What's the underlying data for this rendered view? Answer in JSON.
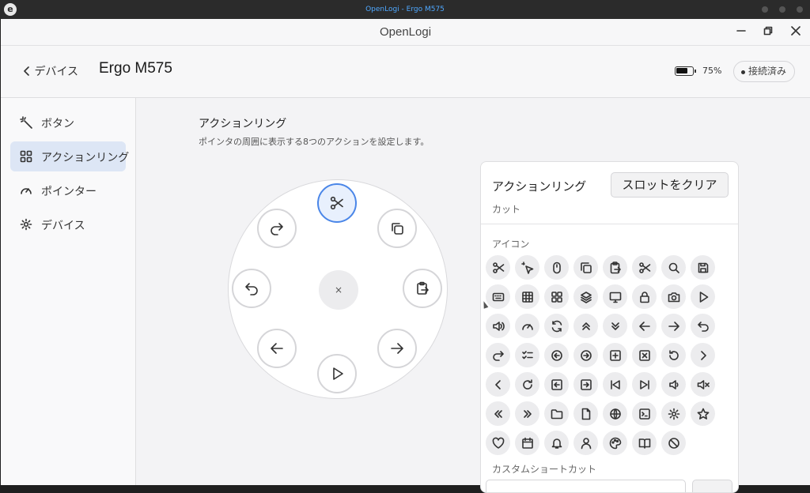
{
  "system": {
    "window_title": "OpenLogi - Ergo M575"
  },
  "app": {
    "title": "OpenLogi"
  },
  "header": {
    "back_label": "デバイス",
    "device_name": "Ergo M575",
    "battery_percent": "75%",
    "battery_level": 0.75,
    "status": "接続済み"
  },
  "sidebar": {
    "items": [
      {
        "label": "ボタン",
        "icon": "wand-icon"
      },
      {
        "label": "アクションリング",
        "icon": "grid-icon",
        "active": true
      },
      {
        "label": "ポインター",
        "icon": "gauge-icon"
      },
      {
        "label": "デバイス",
        "icon": "gear-icon"
      }
    ]
  },
  "main": {
    "title": "アクションリング",
    "description": "ポインタの周囲に表示する8つのアクションを設定します。"
  },
  "ring": {
    "center_label": "×",
    "slots": [
      "scissors-icon",
      "copy-icon",
      "clipboard-icon",
      "arrow-right-icon",
      "play-icon",
      "arrow-left-icon",
      "undo-icon",
      "redo-icon"
    ],
    "selected_slot": "scissors-icon"
  },
  "panel": {
    "title": "アクションリング",
    "clear_button": "スロットをクリア",
    "selected_action": "カット",
    "icons_label": "アイコン",
    "custom_label": "カスタムショートカット"
  },
  "colors": {
    "accent": "#4a86e8",
    "accent_bg": "#e8f0fd",
    "sidebar_active": "#dde6f5"
  }
}
